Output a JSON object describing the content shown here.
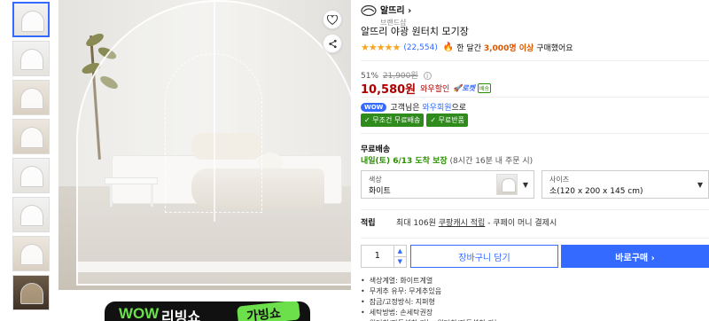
{
  "thumbnails": [
    {
      "tone": "light"
    },
    {
      "tone": "light"
    },
    {
      "tone": "beige"
    },
    {
      "tone": "beige"
    },
    {
      "tone": "light"
    },
    {
      "tone": "light"
    },
    {
      "tone": "beige"
    },
    {
      "tone": "dark"
    }
  ],
  "banner": {
    "wow": "WOW",
    "text": "리빙쇼",
    "badge": "가빙쇼"
  },
  "brand": {
    "name": "알뜨리",
    "sub": "브랜드샵"
  },
  "product": {
    "title": "알뜨리 야광 원터치 모기장",
    "rating_stars": "★★★★★",
    "review_count": "(22,554)",
    "bought_prefix": "한 달간",
    "bought_strong": "3,000명 이상",
    "bought_suffix": "구매했어요"
  },
  "price": {
    "discount": "51%",
    "original": "21,900원",
    "info_icon": "i",
    "sale": "10,580원",
    "sale_label": "와우할인",
    "rocket": "로켓",
    "rocket_tag": "배송"
  },
  "wow": {
    "pill": "WOW",
    "prefix": "고객님은",
    "member": "와우회원",
    "suffix": "으로"
  },
  "chips": [
    "✓ 무조건 무료배송",
    "✓ 무료반품"
  ],
  "shipping": {
    "label": "무료배송",
    "date": "내일(토) 6/13 도착 보장",
    "cutoff": "(8시간 16분 내 주문 시)"
  },
  "options": {
    "color_label": "색상",
    "color_value": "화이트",
    "size_label": "사이즈",
    "size_value": "소(120 x 200 x 145 cm)",
    "caret": "▼"
  },
  "reward": {
    "label": "적립",
    "prefix": "최대 106원",
    "link": "쿠팡캐시 적립",
    "suffix": " - 쿠페이 머니 결제시"
  },
  "purchase": {
    "quantity": "1",
    "up": "▲",
    "down": "▼",
    "cart_label": "장바구니 담기",
    "buy_label": "바로구매 ›"
  },
  "specs": [
    "색상계열: 화이트계열",
    "무게추 유무: 무게추있음",
    "잠금/고정방식: 지퍼형",
    "세탁방법: 손세탁권장",
    "원터치/자동설치 기능: 원터치/자동설치 가능"
  ],
  "colors": {
    "accent": "#346aff",
    "price": "#ae0000",
    "free_ship": "#2e8b1c",
    "rating": "#f5a623"
  }
}
